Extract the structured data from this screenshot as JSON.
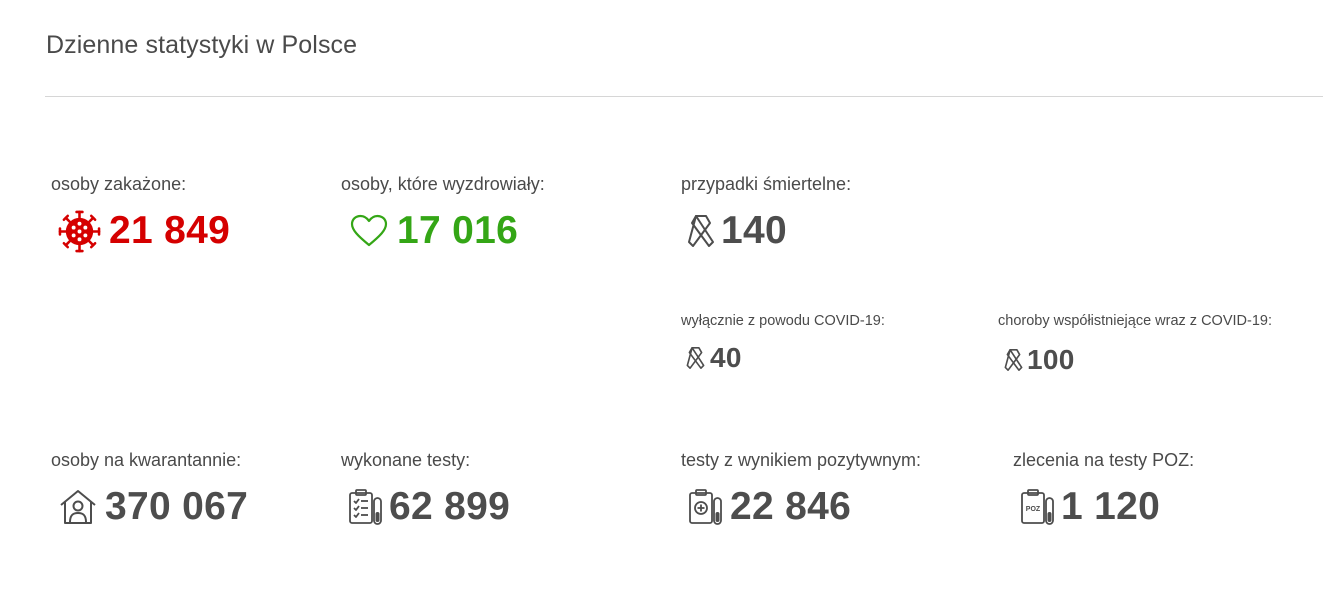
{
  "page": {
    "title": "Dzienne statystyki w Polsce"
  },
  "colors": {
    "infected": "#d50000",
    "recovered": "#34a616",
    "neutral": "#4d4d4d",
    "divider": "#d6d6d6"
  },
  "stats": {
    "infected": {
      "label": "osoby zakażone:",
      "value": "21 849",
      "icon": "virus-icon"
    },
    "recovered": {
      "label": "osoby, które wyzdrowiały:",
      "value": "17 016",
      "icon": "heart-icon"
    },
    "deaths": {
      "label": "przypadki śmiertelne:",
      "value": "140",
      "icon": "ribbon-icon"
    },
    "deaths_covid_only": {
      "label": "wyłącznie z powodu COVID-19:",
      "value": "40",
      "icon": "ribbon-icon"
    },
    "deaths_comorbid": {
      "label": "choroby współistniejące wraz z COVID-19:",
      "value": "100",
      "icon": "ribbon-icon"
    },
    "quarantine": {
      "label": "osoby na kwarantannie:",
      "value": "370 067",
      "icon": "house-person-icon"
    },
    "tests_done": {
      "label": "wykonane testy:",
      "value": "62 899",
      "icon": "clipboard-test-tube-icon"
    },
    "positive_tests": {
      "label": "testy z wynikiem pozytywnym:",
      "value": "22 846",
      "icon": "clipboard-plus-icon"
    },
    "poz_orders": {
      "label": "zlecenia na testy POZ:",
      "value": "1 120",
      "icon": "clipboard-poz-icon",
      "icon_text": "POZ"
    }
  }
}
